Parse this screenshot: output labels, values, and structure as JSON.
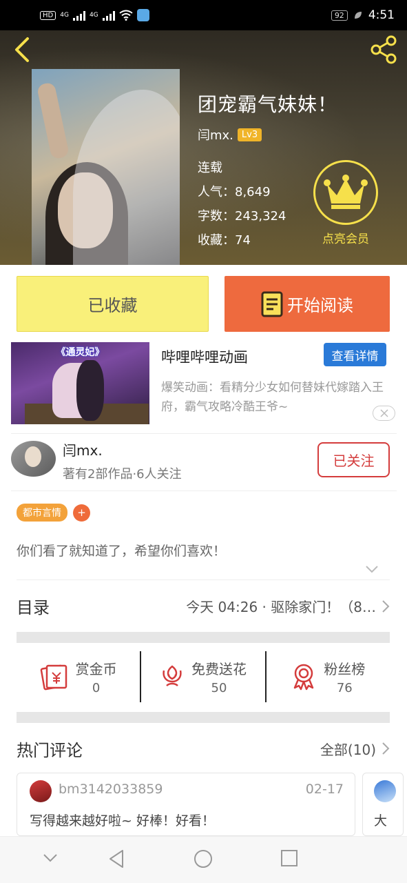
{
  "status_bar": {
    "left_badge": "HD",
    "net1": "4G",
    "net2": "4G",
    "battery": "92",
    "time": "4:51"
  },
  "book": {
    "title": "团宠霸气妹妹！",
    "author": "闫mx.",
    "level": "Lv3",
    "status": "连载",
    "popularity_label": "人气：",
    "popularity": "8,649",
    "words_label": "字数：",
    "words": "243,324",
    "favorites_label": "收藏：",
    "favorites": "74"
  },
  "vip": {
    "label": "点亮会员",
    "icon": "crown-icon",
    "color": "#f6e04b"
  },
  "actions": {
    "favorited_label": "已收藏",
    "read_label": "开始阅读",
    "read_color": "#ee6a3e",
    "fav_color": "#f9f07a"
  },
  "ad": {
    "thumb_title": "《通灵妃》",
    "name": "哔哩哔哩动画",
    "detail_button": "查看详情",
    "description": "爆笑动画：看精分少女如何替妹代嫁踏入王府，霸气攻略冷酷王爷~"
  },
  "author_card": {
    "name": "闫mx.",
    "subtitle": "著有2部作品·6人关注",
    "follow_label": "已关注"
  },
  "tags": {
    "items": [
      "都市言情"
    ],
    "add_label": "+"
  },
  "intro": "你们看了就知道了，希望你们喜欢！",
  "toc": {
    "title": "目录",
    "latest": "今天 04:26 · 驱除家门！（8…"
  },
  "stats": [
    {
      "label": "赏金币",
      "value": "0",
      "icon": "red-envelope-icon"
    },
    {
      "label": "免费送花",
      "value": "50",
      "icon": "flower-icon"
    },
    {
      "label": "粉丝榜",
      "value": "76",
      "icon": "medal-icon"
    }
  ],
  "comments": {
    "title": "热门评论",
    "all_label": "全部(10)",
    "items": [
      {
        "user": "bm3142033859",
        "date": "02-17",
        "text": "写得越来越好啦~ 好棒！好看！"
      },
      {
        "text": "大"
      }
    ]
  },
  "colors": {
    "accent_red": "#d43c3c",
    "tag_orange": "#f3a23a",
    "ad_blue": "#2a7ad8"
  }
}
